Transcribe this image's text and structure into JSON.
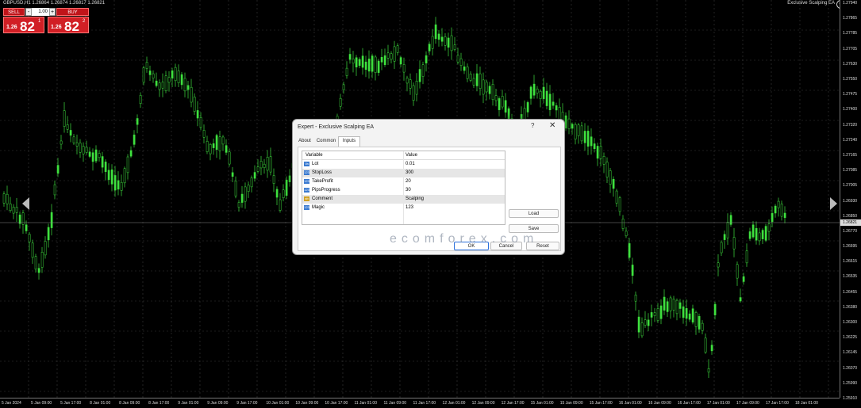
{
  "chart": {
    "symbol_info": "GBPUSD,H1  1.26864 1.26874 1.26817 1.26821",
    "ea_label": "Exclusive Scalping EA",
    "smiley": "☺",
    "candle_color": "#3ee03e",
    "grid_color": "#3a3a3a",
    "current_price": "1.26821",
    "price_labels": [
      "1.27940",
      "1.27865",
      "1.27785",
      "1.27705",
      "1.27630",
      "1.27550",
      "1.27475",
      "1.27400",
      "1.27320",
      "1.27240",
      "1.27165",
      "1.27085",
      "1.27005",
      "1.26930",
      "1.26850",
      "1.26770",
      "1.26695",
      "1.26615",
      "1.26535",
      "1.26455",
      "1.26380",
      "1.26300",
      "1.26225",
      "1.26145",
      "1.26070",
      "1.25990",
      "1.25910"
    ],
    "time_labels": [
      "5 Jan 2024",
      "5 Jan 09:00",
      "5 Jan 17:00",
      "8 Jan 01:00",
      "8 Jan 09:00",
      "8 Jan 17:00",
      "9 Jan 01:00",
      "9 Jan 09:00",
      "9 Jan 17:00",
      "10 Jan 01:00",
      "10 Jan 09:00",
      "10 Jan 17:00",
      "11 Jan 01:00",
      "11 Jan 09:00",
      "11 Jan 17:00",
      "12 Jan 01:00",
      "12 Jan 09:00",
      "12 Jan 17:00",
      "15 Jan 01:00",
      "15 Jan 09:00",
      "15 Jan 17:00",
      "16 Jan 01:00",
      "16 Jan 09:00",
      "16 Jan 17:00",
      "17 Jan 01:00",
      "17 Jan 09:00",
      "17 Jan 17:00",
      "18 Jan 01:00"
    ]
  },
  "one_click": {
    "sell_label": "SELL",
    "buy_label": "BUY",
    "lot_value": "1.00",
    "minus": "-",
    "plus": "+",
    "sell_small": "1.26",
    "sell_big": "82",
    "sell_sup": "1",
    "buy_small": "1.26",
    "buy_big": "82",
    "buy_sup": "2"
  },
  "dialog": {
    "title": "Expert - Exclusive Scalping EA",
    "help": "?",
    "close": "✕",
    "tabs": [
      "About",
      "Common",
      "Inputs"
    ],
    "active_tab": "Inputs",
    "columns": [
      "Variable",
      "Value"
    ],
    "rows": [
      {
        "name": "Lot",
        "value": "0.01"
      },
      {
        "name": "StopLoss",
        "value": "300"
      },
      {
        "name": "TakeProfit",
        "value": "20"
      },
      {
        "name": "PipsProgress",
        "value": "30"
      },
      {
        "name": "Comment",
        "value": "Scalping"
      },
      {
        "name": "Magic",
        "value": "123"
      }
    ],
    "buttons": {
      "load": "Load",
      "save": "Save",
      "ok": "OK",
      "cancel": "Cancel",
      "reset": "Reset"
    }
  },
  "watermark": {
    "text": "ecomforex.com"
  }
}
